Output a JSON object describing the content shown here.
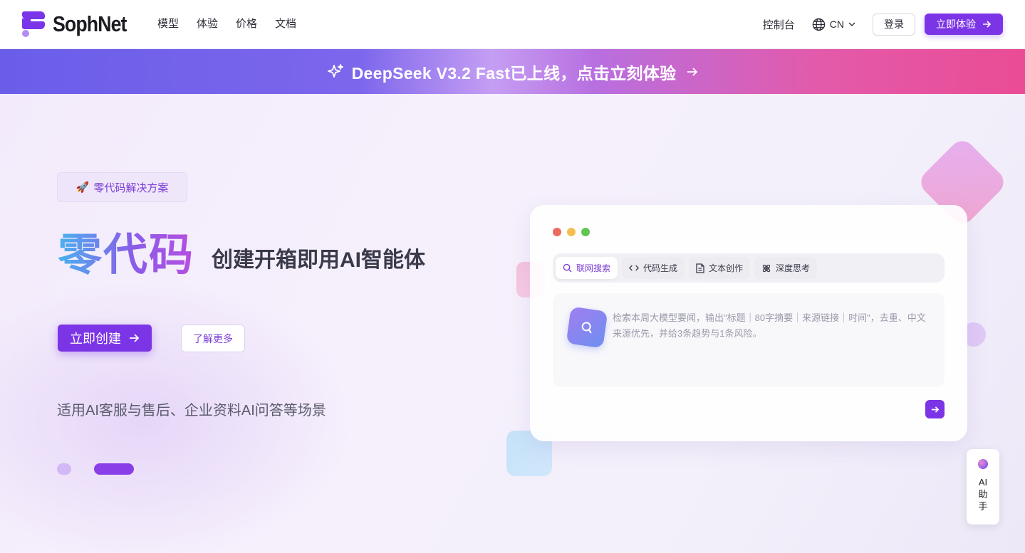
{
  "header": {
    "logo_text": "SophNet",
    "nav": [
      "模型",
      "体验",
      "价格",
      "文档"
    ],
    "console": "控制台",
    "lang": "CN",
    "login": "登录",
    "try_now": "立即体验"
  },
  "banner": {
    "text": "DeepSeek V3.2 Fast已上线，点击立刻体验"
  },
  "hero": {
    "tag": "零代码解决方案",
    "tag_emoji": "🚀",
    "headline_big": "零代码",
    "headline_sub": "创建开箱即用AI智能体",
    "create_button": "立即创建",
    "more_button": "了解更多",
    "description": "适用AI客服与售后、企业资料AI问答等场景"
  },
  "card": {
    "tabs": [
      "联网搜索",
      "代码生成",
      "文本创作",
      "深度思考"
    ],
    "active_tab": 0,
    "prompt": "检索本周大模型要闻，输出\"标题｜80字摘要｜来源链接｜时间\"，去重、中文来源优先，并给3条趋势与1条风险。"
  },
  "ai_helper": {
    "label": "AI助手"
  },
  "colors": {
    "accent": "#7c35e6",
    "window_red": "#ed6a5e",
    "window_yellow": "#f5bf4f",
    "window_green": "#61c554"
  }
}
